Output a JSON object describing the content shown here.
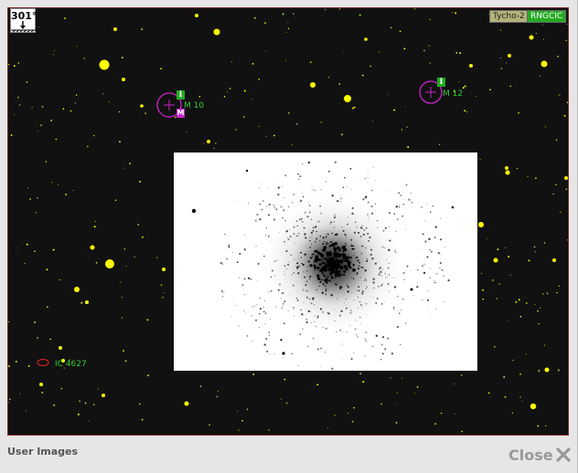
{
  "sky_view": {
    "rotation_angle": "301°",
    "catalogs": [
      "Tycho-2",
      "RNGCIC"
    ],
    "objects": {
      "m10": "M 10",
      "m12": "M 12",
      "ic4627": "IC 4627"
    },
    "info_marker": "i",
    "m_marker": "M"
  },
  "footer": {
    "title": "User Images",
    "close_label": "Close"
  },
  "colors": {
    "sky": "#111111",
    "star": "#ffff00",
    "label": "#33cc33",
    "circle": "#cc22cc",
    "ellipse": "#cc2222"
  },
  "icons": {
    "close": "close-x-icon",
    "angle": "compass-arrow-icon"
  }
}
